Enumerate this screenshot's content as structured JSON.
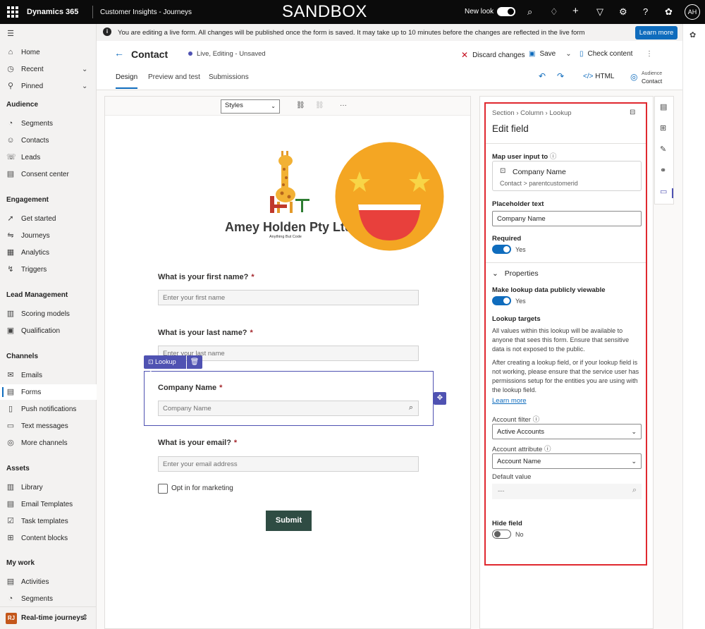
{
  "topbar": {
    "product": "Dynamics 365",
    "app": "Customer Insights - Journeys",
    "environment": "SANDBOX",
    "new_look_label": "New look",
    "user_initials": "AH"
  },
  "banner": {
    "message": "You are editing a live form. All changes will be published once the form is saved. It may take up to 10 minutes before the changes are reflected in the live form",
    "button": "Learn more"
  },
  "sidebar": {
    "top": [
      {
        "label": "Home",
        "icon": "home-icon"
      },
      {
        "label": "Recent",
        "icon": "clock-icon"
      },
      {
        "label": "Pinned",
        "icon": "pin-icon"
      }
    ],
    "sections": {
      "audience": "Audience",
      "engagement": "Engagement",
      "lead": "Lead Management",
      "channels": "Channels",
      "assets": "Assets",
      "mywork": "My work"
    },
    "items": {
      "segments": "Segments",
      "contacts": "Contacts",
      "leads": "Leads",
      "consent": "Consent center",
      "get_started": "Get started",
      "journeys": "Journeys",
      "analytics": "Analytics",
      "triggers": "Triggers",
      "scoring": "Scoring models",
      "qualification": "Qualification",
      "emails": "Emails",
      "forms": "Forms",
      "push": "Push notifications",
      "text": "Text messages",
      "more": "More channels",
      "library": "Library",
      "email_templates": "Email Templates",
      "task_templates": "Task templates",
      "content_blocks": "Content blocks",
      "activities": "Activities",
      "segments2": "Segments"
    },
    "area_badge": "RJ",
    "area": "Real-time journeys"
  },
  "header": {
    "title": "Contact",
    "status": "Live, Editing - Unsaved",
    "discard": "Discard changes",
    "save": "Save",
    "check": "Check content",
    "tabs": [
      "Design",
      "Preview and test",
      "Submissions"
    ],
    "html": "HTML",
    "audience_label": "Audience",
    "audience_value": "Contact"
  },
  "canvas": {
    "styles_select": "Styles",
    "company": "Amey Holden Pty Ltd",
    "tagline": "Anything But Code",
    "fields": [
      {
        "label": "What is your first name?",
        "placeholder": "Enter your first name"
      },
      {
        "label": "What is your last name?",
        "placeholder": "Enter your last name"
      },
      {
        "label": "Company Name",
        "placeholder": "Company Name"
      },
      {
        "label": "What is your email?",
        "placeholder": "Enter your email address"
      }
    ],
    "required_mark": "*",
    "lookup_tag": "Lookup",
    "optin": "Opt in for marketing",
    "submit": "Submit"
  },
  "panel": {
    "breadcrumb": [
      "Section",
      "Column",
      "Lookup"
    ],
    "title": "Edit field",
    "map_label": "Map user input to",
    "map_name": "Company Name",
    "map_path": "Contact  >  parentcustomerid",
    "placeholder_label": "Placeholder text",
    "placeholder_value": "Company Name",
    "required_label": "Required",
    "required_value": "Yes",
    "properties": "Properties",
    "public_label": "Make lookup data publicly viewable",
    "public_value": "Yes",
    "targets_label": "Lookup targets",
    "targets_p1": "All values within this lookup will be available to anyone that sees this form. Ensure that sensitive data is not exposed to the public.",
    "targets_p2": "After creating a lookup field, or if your lookup field is not working, please ensure that the service user has permissions setup for the entities you are using with the lookup field.",
    "learn_more": "Learn more",
    "account_filter_label": "Account filter",
    "account_filter_value": "Active Accounts",
    "account_attr_label": "Account attribute",
    "account_attr_value": "Account Name",
    "default_label": "Default value",
    "default_value": "---",
    "hide_label": "Hide field",
    "hide_value": "No"
  }
}
